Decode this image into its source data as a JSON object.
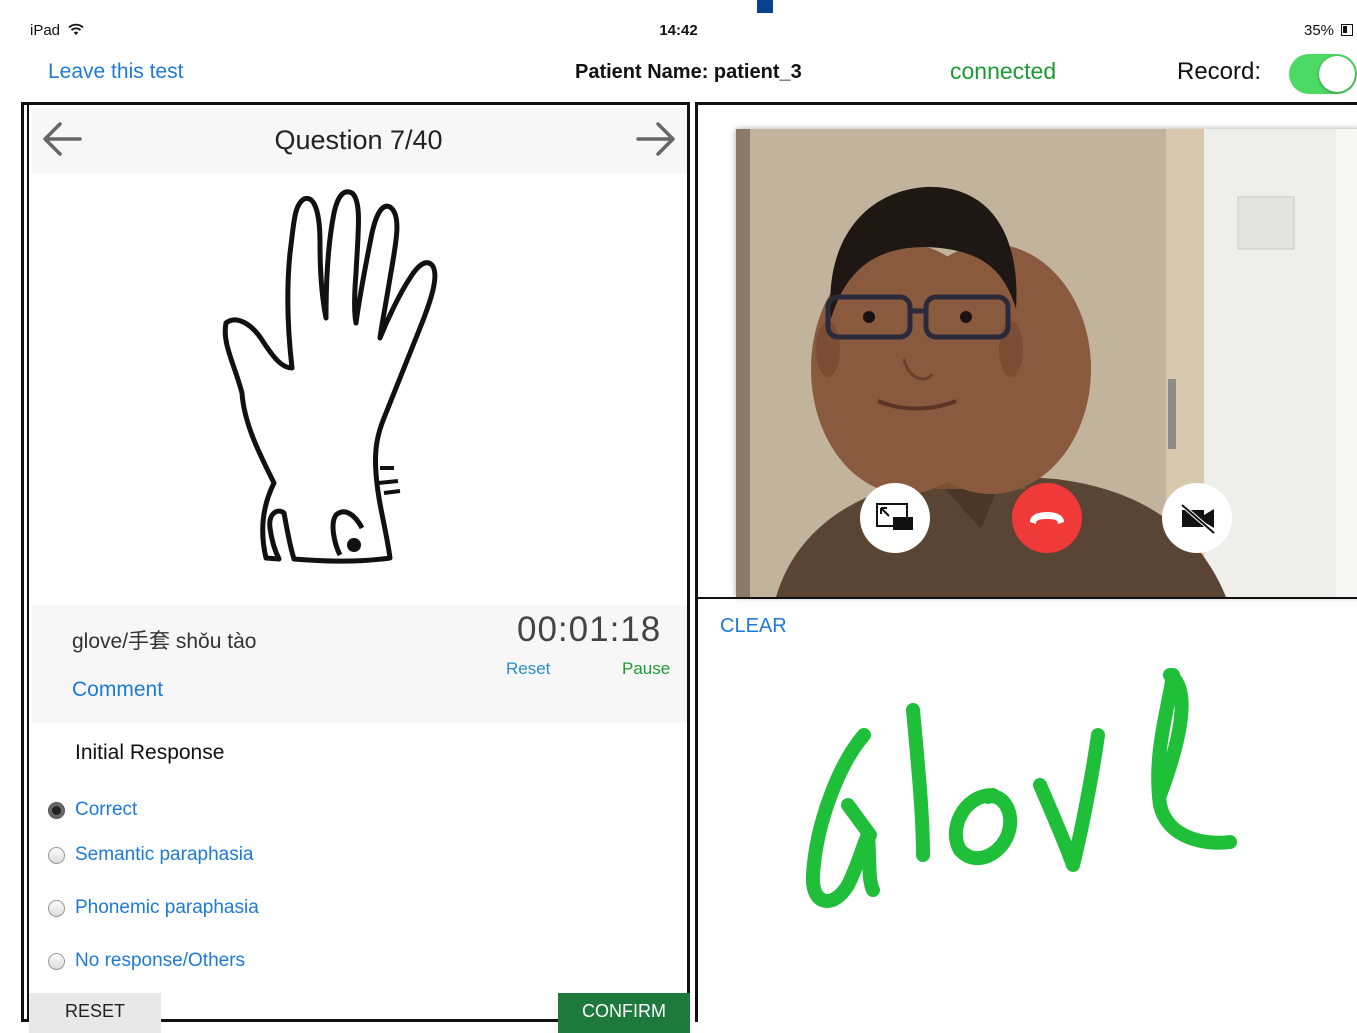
{
  "status_bar": {
    "device": "iPad",
    "time": "14:42",
    "battery": "35%"
  },
  "nav": {
    "leave": "Leave this test",
    "patient_label": "Patient Name: patient_3",
    "connection": "connected",
    "record_label": "Record:",
    "record_on": true
  },
  "question": {
    "title": "Question 7/40",
    "word": "glove/手套 shǒu tào",
    "comment": "Comment",
    "timer": "00:01:18",
    "timer_reset": "Reset",
    "timer_pause": "Pause"
  },
  "response": {
    "label": "Initial Response",
    "options": [
      "Correct",
      "Semantic paraphasia",
      "Phonemic paraphasia",
      "No response/Others"
    ],
    "selected": "Correct"
  },
  "buttons": {
    "reset": "RESET",
    "confirm": "CONFIRM"
  },
  "video": {
    "buttons": [
      "pip-icon",
      "hangup-icon",
      "camera-off-icon"
    ],
    "colors": {
      "hangup": "#f03a3a"
    }
  },
  "canvas": {
    "clear": "CLEAR",
    "ink_color": "#1fbf3a"
  },
  "colors": {
    "link": "#1d7ad9",
    "connected": "#1a9c30",
    "toggle_on": "#4cd964",
    "confirm_bg": "#1e7a3c"
  }
}
